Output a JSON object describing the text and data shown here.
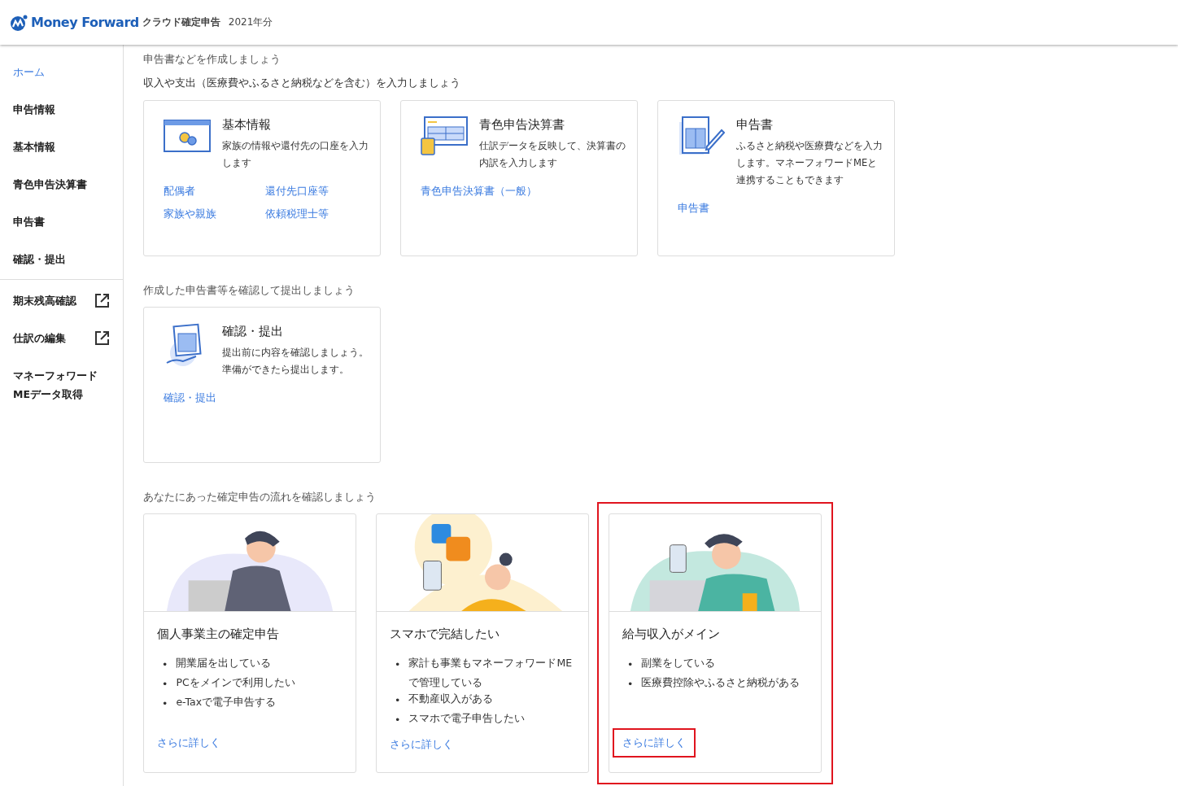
{
  "header": {
    "brand": "Money Forward",
    "product": "クラウド確定申告",
    "year": "2021年分"
  },
  "sidebar": {
    "items": [
      {
        "label": "ホーム",
        "selected": true,
        "external": false
      },
      {
        "label": "申告情報",
        "selected": false,
        "external": false
      },
      {
        "label": "基本情報",
        "selected": false,
        "external": false
      },
      {
        "label": "青色申告決算書",
        "selected": false,
        "external": false
      },
      {
        "label": "申告書",
        "selected": false,
        "external": false
      },
      {
        "label": "確認・提出",
        "selected": false,
        "external": false
      },
      {
        "label": "期末残高確認",
        "selected": false,
        "external": true
      },
      {
        "label": "仕訳の編集",
        "selected": false,
        "external": true
      },
      {
        "label": "マネーフォワード\nMEデータ取得",
        "selected": false,
        "external": false
      }
    ]
  },
  "sections": [
    {
      "title": "申告書などを作成しましょう",
      "subtitle": "収入や支出（医療費やふるさと納税などを含む）を入力しましょう",
      "kind": "tasks",
      "cards": [
        {
          "title": "基本情報",
          "description": "家族の情報や還付先の口座を入力します",
          "links": [
            "配偶者",
            "還付先口座等",
            "家族や親族",
            "依頼税理士等"
          ]
        },
        {
          "title": "青色申告決算書",
          "description": "仕訳データを反映して、決算書の内訳を入力します",
          "links": [
            "青色申告決算書（一般）"
          ]
        },
        {
          "title": "申告書",
          "description": "ふるさと納税や医療費などを入力します。マネーフォワードMEと連携することもできます",
          "links": [
            "申告書"
          ]
        }
      ]
    },
    {
      "title": "作成した申告書等を確認して提出しましょう",
      "kind": "tasks",
      "cards": [
        {
          "title": "確認・提出",
          "description": "提出前に内容を確認しましょう。準備ができたら提出します。",
          "links": [
            "確認・提出"
          ]
        }
      ]
    },
    {
      "title": "あなたにあった確定申告の流れを確認しましょう",
      "kind": "flows",
      "cards": [
        {
          "title": "個人事業主の確定申告",
          "points": [
            {
              "bullet": "•",
              "text": "開業届を出している"
            },
            {
              "bullet": "•",
              "text": "PCをメインで利用したい"
            },
            {
              "bullet": "•",
              "text": "e-Taxで電子申告する"
            }
          ],
          "link": "さらに詳しく",
          "highlighted": false
        },
        {
          "title": "スマホで完結したい",
          "points": [
            {
              "bullet": "•",
              "text": "家計も事業もマネーフォワードMEで管理している"
            },
            {
              "bullet": "•",
              "text": "不動産収入がある"
            },
            {
              "bullet": "•",
              "text": "スマホで電子申告したい"
            }
          ],
          "link": "さらに詳しく",
          "highlighted": false
        },
        {
          "title": "給与収入がメイン",
          "points": [
            {
              "bullet": "•",
              "text": "副業をしている"
            },
            {
              "bullet": "•",
              "text": "医療費控除やふるさと納税がある"
            }
          ],
          "link": "さらに詳しく",
          "highlighted": true
        }
      ]
    }
  ]
}
